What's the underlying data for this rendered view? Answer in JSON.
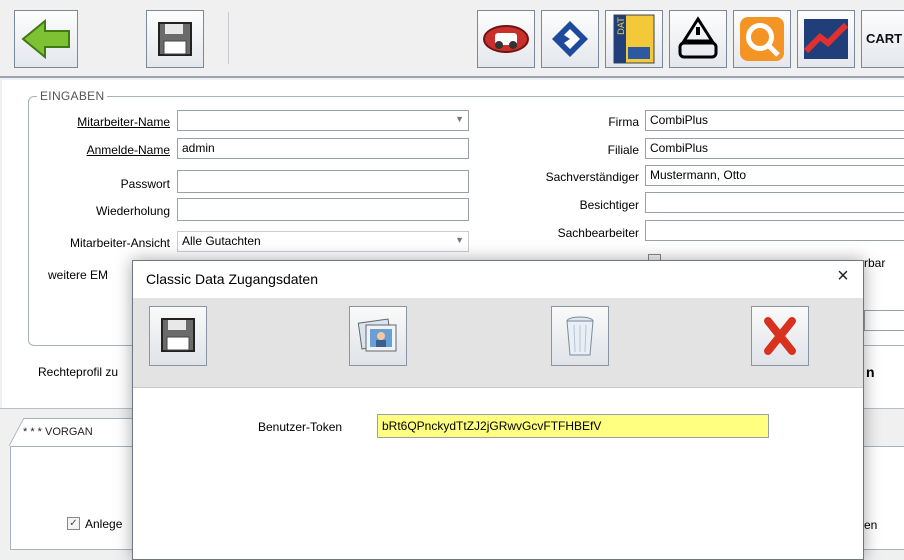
{
  "toolbar": {
    "back_icon": "back-arrow-icon",
    "save_icon": "floppy-disk-icon",
    "brand_buttons": [
      "carbase-logo",
      "blue-chevron-logo",
      "dat-logo",
      "warning-car-logo",
      "search-car-logo",
      "red-chart-logo"
    ],
    "cart_label": "CART"
  },
  "form": {
    "group_title": "EINGABEN",
    "left": {
      "employee_name_label": "Mitarbeiter-Name",
      "employee_name_value": "",
      "login_name_label": "Anmelde-Name",
      "login_name_value": "admin",
      "password_label": "Passwort",
      "password_value": "",
      "repeat_label": "Wiederholung",
      "repeat_value": "",
      "view_label": "Mitarbeiter-Ansicht",
      "view_value": "Alle Gutachten",
      "more_emails_label": "weitere EM"
    },
    "right": {
      "company_label": "Firma",
      "company_value": "CombiPlus",
      "branch_label": "Filiale",
      "branch_value": "CombiPlus",
      "expert_label": "Sachverständiger",
      "expert_value": "Mustermann, Otto",
      "inspector_label": "Besichtiger",
      "inspector_value": "",
      "clerk_label": "Sachbearbeiter",
      "clerk_value": "",
      "partial_right_text": "rbar"
    },
    "rights_profile_label": "Rechteprofil zu",
    "partial_bold_char": "n"
  },
  "lower": {
    "tab_label": "* * * VORGAN",
    "checkbox_label": "Anlege",
    "checkbox_checked": true,
    "partial_right_text": "en"
  },
  "dialog": {
    "title": "Classic Data Zugangsdaten",
    "close_symbol": "×",
    "buttons": [
      "save",
      "picture",
      "recycle-bin",
      "delete"
    ],
    "token_label": "Benutzer-Token",
    "token_value": "bRt6QPnckydTtZJ2jGRwvGcvFTFHBEfV",
    "token_bg": "#ffff80"
  }
}
